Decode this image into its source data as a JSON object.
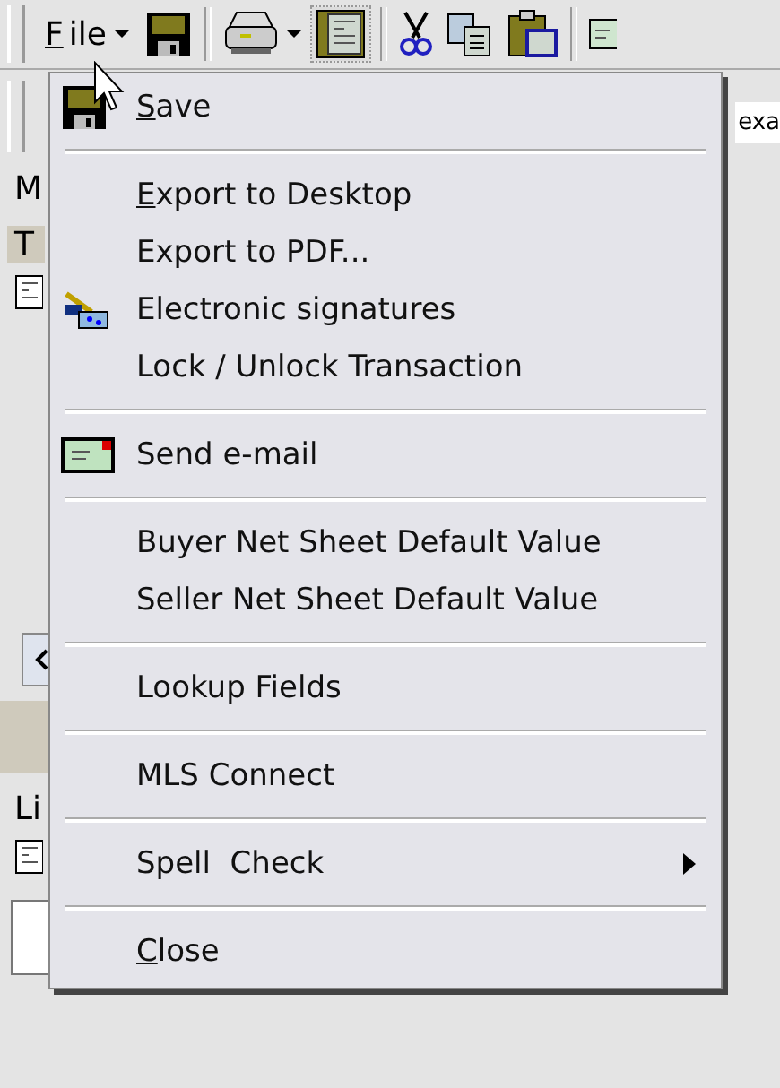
{
  "toolbar": {
    "file_button": {
      "label": "File",
      "access_key_underlined": true
    }
  },
  "background": {
    "tab_fragments": [
      "M",
      "T"
    ],
    "list_fragment": "Li",
    "field_fragment": "exa"
  },
  "menu": {
    "items": [
      {
        "kind": "save",
        "label": "Save",
        "access_key_underlined": true,
        "submenu": false
      },
      {
        "kind": "separator"
      },
      {
        "kind": "plain",
        "label": "Export to Desktop",
        "access_key_underlined": true,
        "submenu": false
      },
      {
        "kind": "plain",
        "label": "Export to PDF...",
        "access_key_underlined": false,
        "submenu": false
      },
      {
        "kind": "signature",
        "label": "Electronic signatures",
        "access_key_underlined": false,
        "submenu": false
      },
      {
        "kind": "plain",
        "label": "Lock / Unlock Transaction",
        "access_key_underlined": false,
        "submenu": false
      },
      {
        "kind": "separator"
      },
      {
        "kind": "email",
        "label": "Send e-mail",
        "access_key_underlined": false,
        "submenu": false
      },
      {
        "kind": "separator"
      },
      {
        "kind": "plain",
        "label": "Buyer Net Sheet Default Value",
        "access_key_underlined": false,
        "submenu": false
      },
      {
        "kind": "plain",
        "label": "Seller Net Sheet Default Value",
        "access_key_underlined": false,
        "submenu": false
      },
      {
        "kind": "separator"
      },
      {
        "kind": "plain",
        "label": "Lookup Fields",
        "access_key_underlined": false,
        "submenu": false
      },
      {
        "kind": "separator"
      },
      {
        "kind": "plain",
        "label": "MLS Connect",
        "access_key_underlined": false,
        "submenu": false
      },
      {
        "kind": "separator"
      },
      {
        "kind": "plain",
        "label": "Spell  Check",
        "access_key_underlined": false,
        "submenu": true
      },
      {
        "kind": "separator"
      },
      {
        "kind": "plain",
        "label": "Close",
        "access_key_underlined": true,
        "submenu": false
      }
    ]
  }
}
